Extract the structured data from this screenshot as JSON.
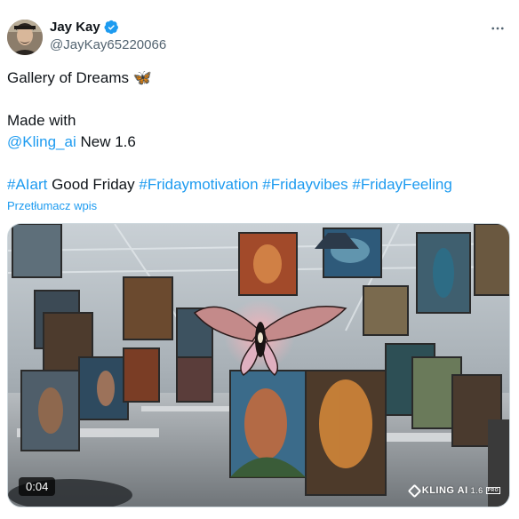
{
  "author": {
    "name": "Jay Kay",
    "handle": "@JayKay65220066",
    "verified": true,
    "avatar_icon": "avatar-portrait"
  },
  "more_icon": "more-horizontal-icon",
  "tweet": {
    "line1": "Gallery of Dreams",
    "line1_emoji": "🦋",
    "line2": "Made with",
    "mention": "@Kling_ai",
    "line3_rest": " New 1.6",
    "hashtag1": "#AIart",
    "plain1": " Good Friday ",
    "hashtag2": "#Fridaymotivation",
    "hashtag3": "#Fridayvibes",
    "hashtag4": "#FridayFeeling"
  },
  "translate_label": "Przetłumacz wpis",
  "media": {
    "duration": "0:04",
    "watermark_brand": "KLING AI",
    "watermark_version": "1.6",
    "watermark_badge": "PRO"
  },
  "colors": {
    "link": "#1d9bf0",
    "verified": "#1d9bf0",
    "text": "#0f1419",
    "secondary": "#536471"
  }
}
